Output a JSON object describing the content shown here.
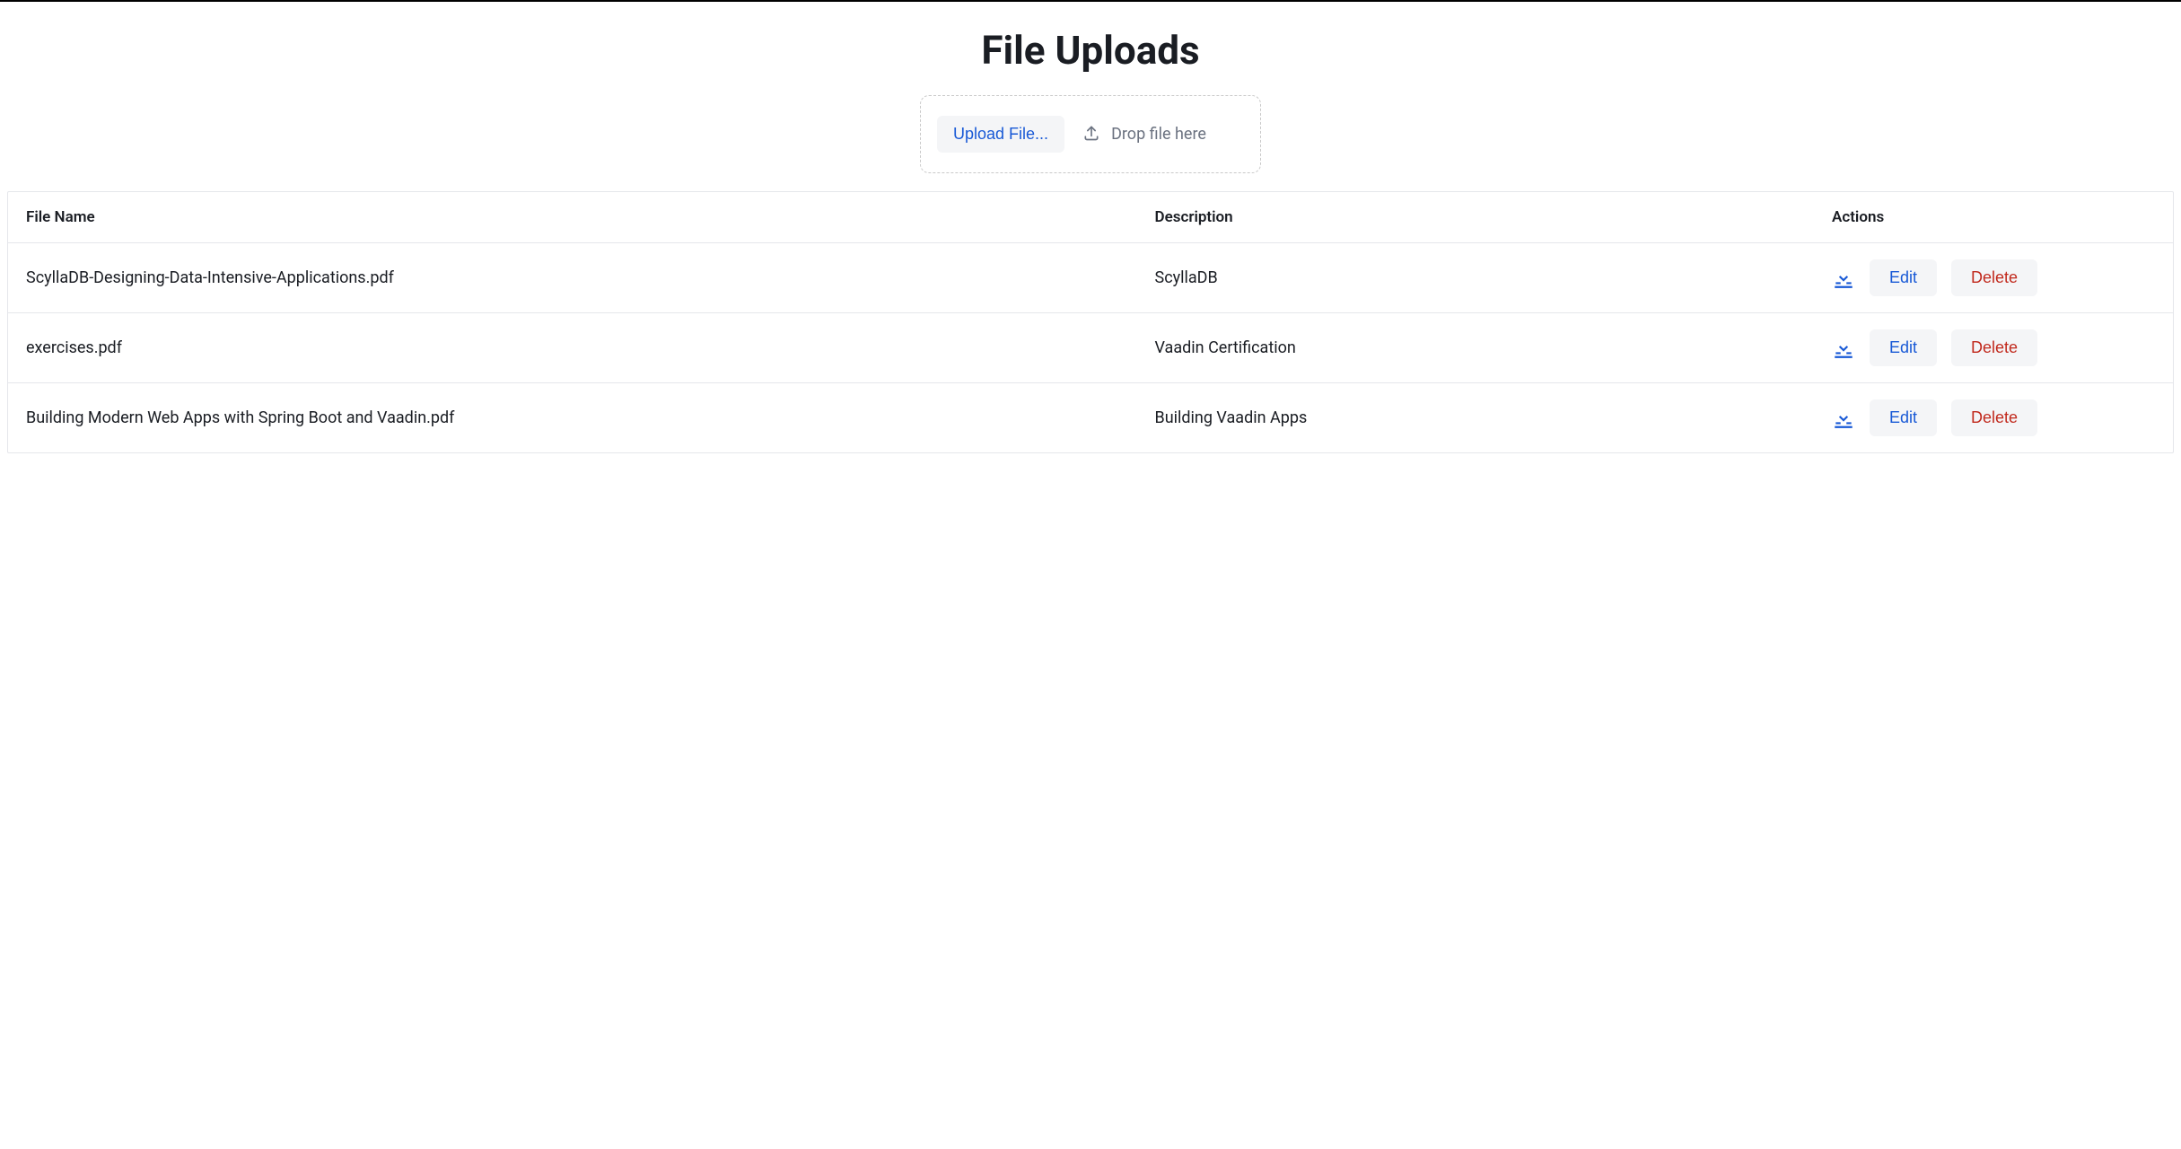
{
  "title": "File Uploads",
  "upload": {
    "button_label": "Upload File...",
    "drop_label": "Drop file here"
  },
  "columns": {
    "filename": "File Name",
    "description": "Description",
    "actions": "Actions"
  },
  "actions": {
    "edit_label": "Edit",
    "delete_label": "Delete"
  },
  "rows": [
    {
      "filename": "ScyllaDB-Designing-Data-Intensive-Applications.pdf",
      "description": "ScyllaDB"
    },
    {
      "filename": "exercises.pdf",
      "description": "Vaadin Certification"
    },
    {
      "filename": "Building Modern Web Apps with Spring Boot and Vaadin.pdf",
      "description": "Building Vaadin Apps"
    }
  ]
}
